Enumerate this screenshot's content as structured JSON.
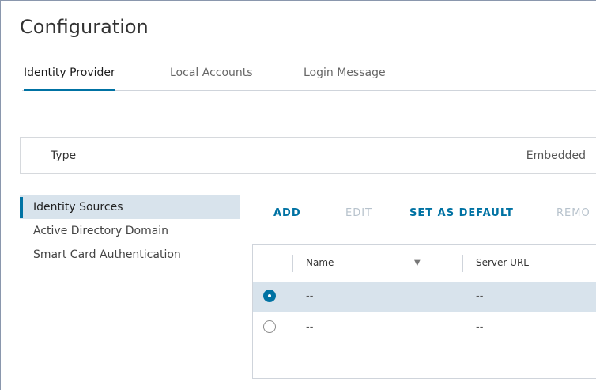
{
  "page": {
    "title": "Configuration"
  },
  "tabs": [
    {
      "label": "Identity Provider",
      "active": true
    },
    {
      "label": "Local Accounts",
      "active": false
    },
    {
      "label": "Login Message",
      "active": false
    }
  ],
  "type_bar": {
    "label": "Type",
    "value": "Embedded"
  },
  "nav": [
    {
      "label": "Identity Sources",
      "active": true
    },
    {
      "label": "Active Directory Domain",
      "active": false
    },
    {
      "label": "Smart Card Authentication",
      "active": false
    }
  ],
  "actions": {
    "add": "ADD",
    "edit": "EDIT",
    "set_default": "SET AS DEFAULT",
    "remove": "REMO"
  },
  "grid": {
    "columns": {
      "name": "Name",
      "server_url": "Server URL"
    },
    "rows": [
      {
        "name": "--",
        "server_url": "--",
        "selected": true
      },
      {
        "name": "--",
        "server_url": "--",
        "selected": false
      }
    ]
  },
  "icons": {
    "filter": "filter-icon",
    "radio_selected": "radio-selected-icon",
    "radio_empty": "radio-empty-icon"
  },
  "colors": {
    "accent": "#0072a3",
    "selected_row": "#d8e3ec"
  }
}
